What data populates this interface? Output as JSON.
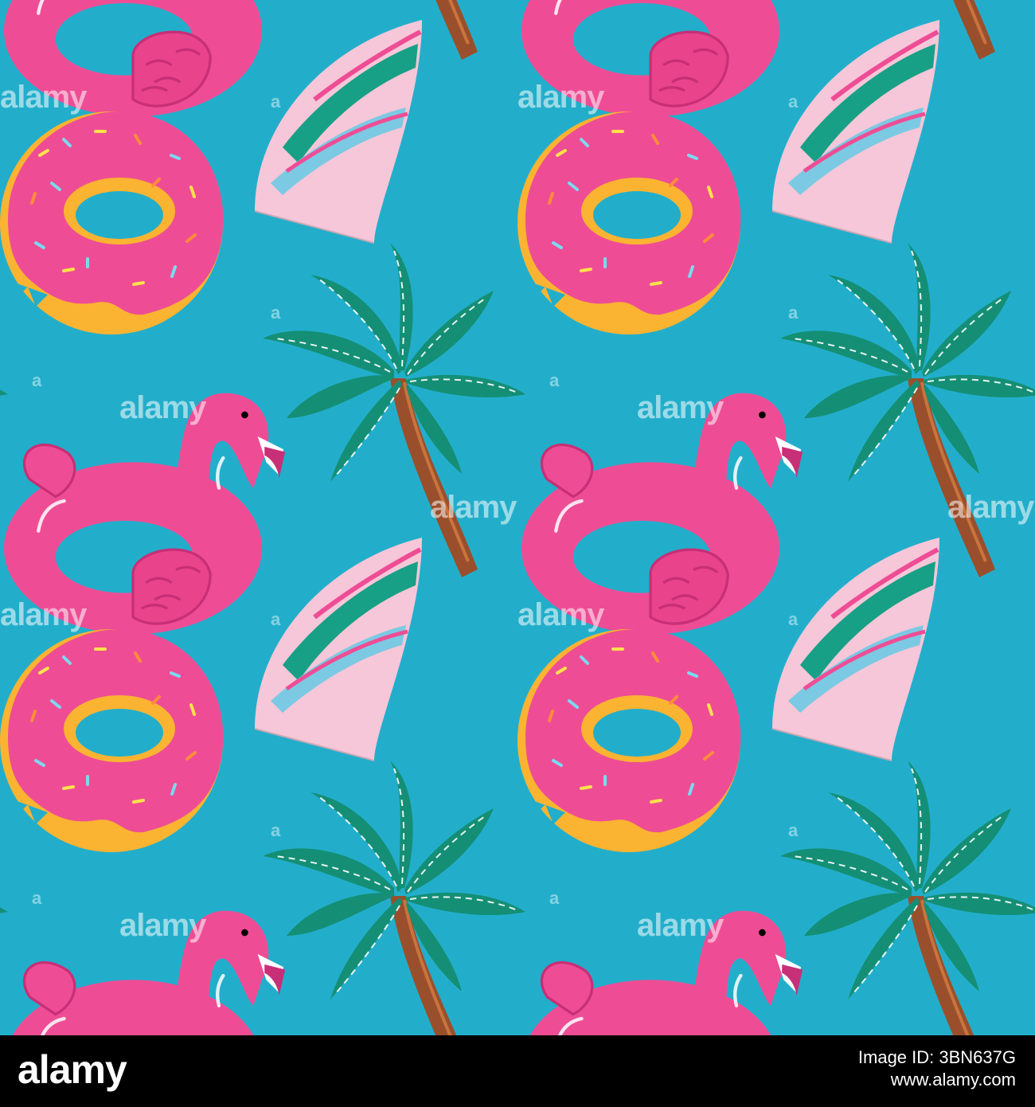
{
  "pattern": {
    "background": "#22aecb",
    "motifs": [
      "flamingo-float-icon",
      "donut-float-icon",
      "surfboard-icon",
      "palm-tree-icon"
    ],
    "colors": {
      "flamingo": "#ee4d95",
      "flamingo_shade": "#c72f76",
      "donut_frosting": "#ee4d95",
      "donut_dough": "#fbb332",
      "leaf": "#148f75",
      "trunk": "#9a4f2c",
      "board_pink": "#f6c7d8",
      "board_green": "#17a085",
      "board_blue": "#7cc9e3"
    }
  },
  "watermark": {
    "text": "alamy",
    "mark": "a"
  },
  "footer": {
    "logo": "alamy",
    "image_id": "Image ID: 3BN637G",
    "site": "www.alamy.com"
  }
}
